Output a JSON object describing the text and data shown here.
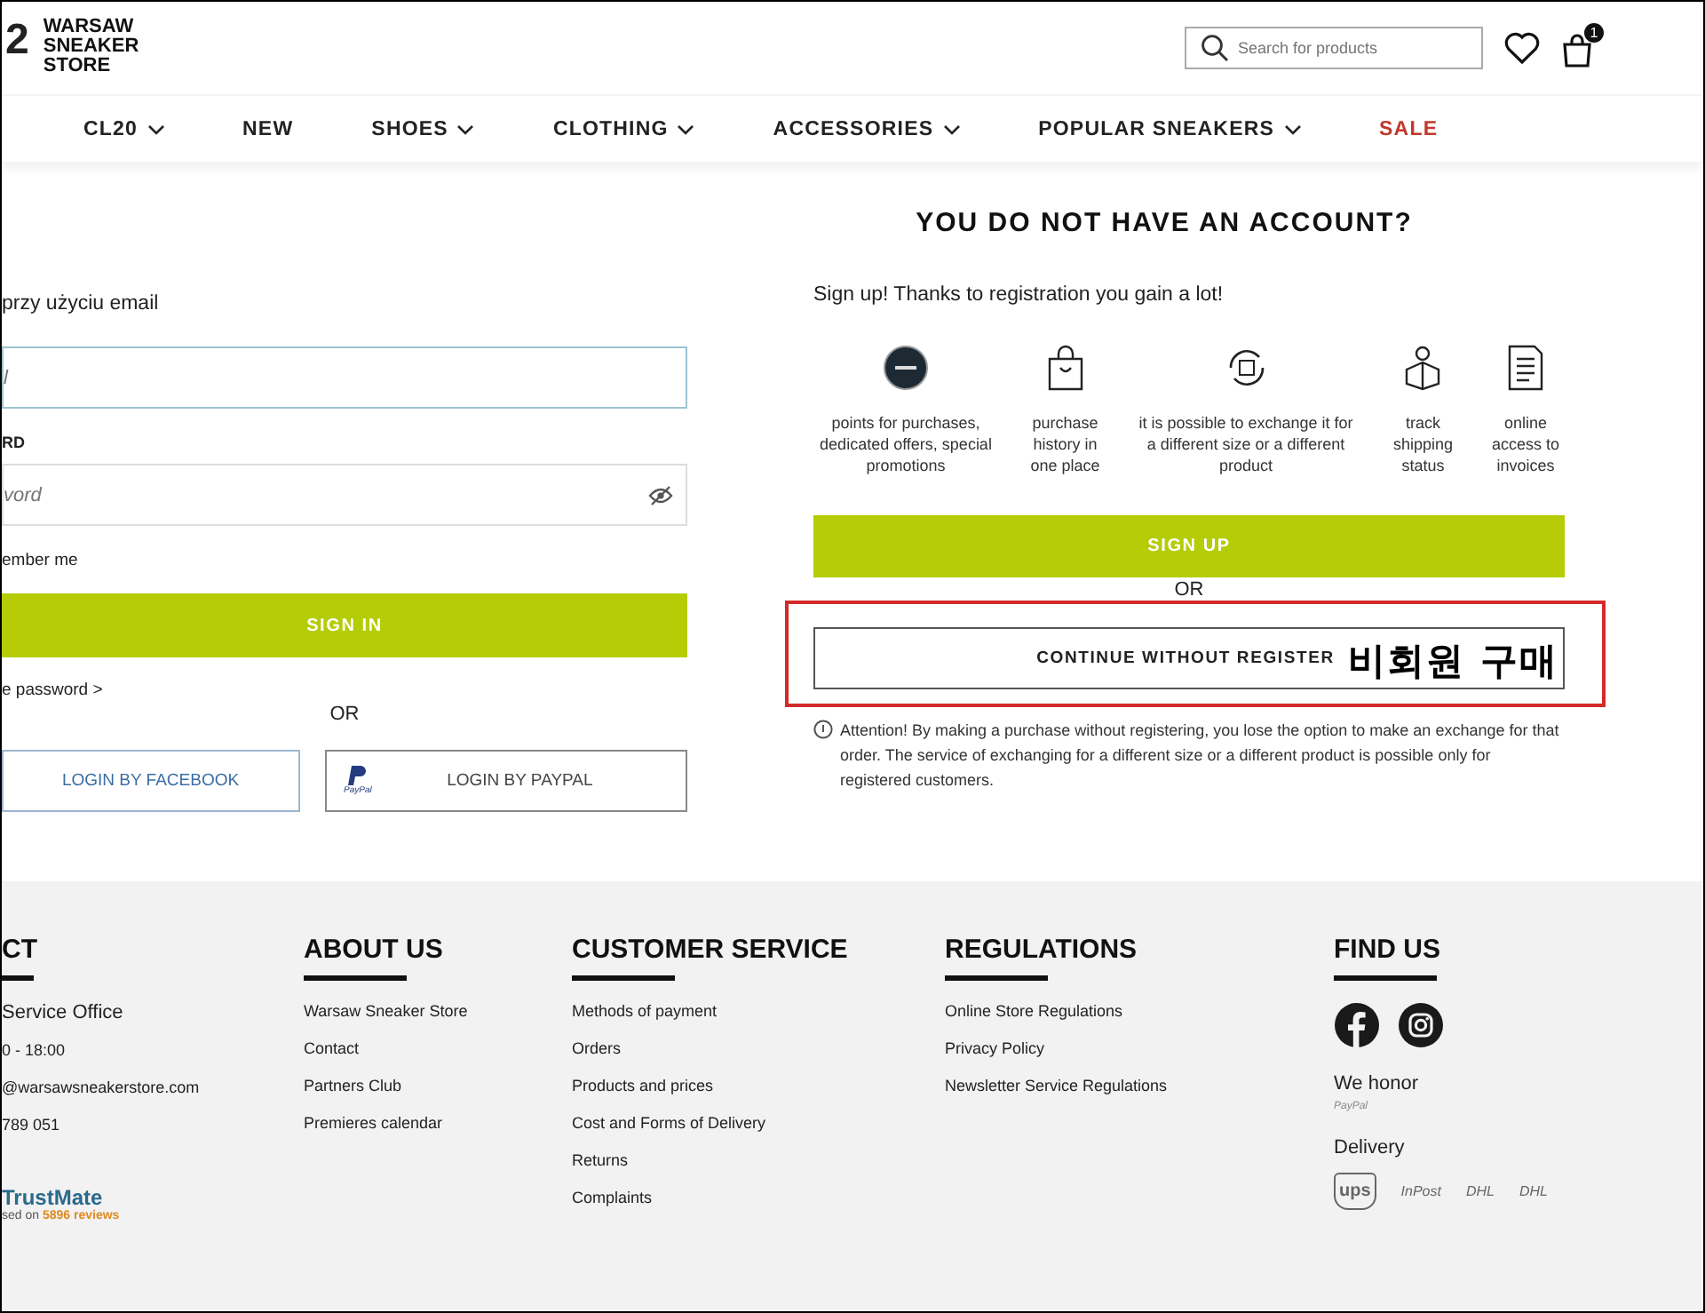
{
  "header": {
    "logo_mark": "2",
    "logo_text": [
      "WARSAW",
      "SNEAKER",
      "STORE"
    ],
    "search": {
      "placeholder": "Search for products"
    },
    "cart_count": "1"
  },
  "nav": [
    {
      "label": "CL20",
      "has_menu": true,
      "highlighted": false
    },
    {
      "label": "NEW",
      "has_menu": false,
      "highlighted": false
    },
    {
      "label": "SHOES",
      "has_menu": true,
      "highlighted": false
    },
    {
      "label": "CLOTHING",
      "has_menu": true,
      "highlighted": false
    },
    {
      "label": "ACCESSORIES",
      "has_menu": true,
      "highlighted": false
    },
    {
      "label": "POPULAR SNEAKERS",
      "has_menu": true,
      "highlighted": false
    },
    {
      "label": "SALE",
      "has_menu": false,
      "highlighted": true
    }
  ],
  "login": {
    "intro": "przy użyciu email",
    "email_field": {
      "placeholder": "l"
    },
    "password_label": "RD",
    "password_field": {
      "placeholder": "vord"
    },
    "remember": "ember me",
    "sign_in": "SIGN IN",
    "forgot": "e password >",
    "or": "OR",
    "facebook": "LOGIN BY FACEBOOK",
    "paypal": "LOGIN BY PAYPAL",
    "paypal_logo": "PayPal"
  },
  "register": {
    "title": "YOU DO NOT HAVE AN ACCOUNT?",
    "intro": "Sign up! Thanks to registration you gain a lot!",
    "benefits": [
      {
        "kind": "club",
        "text": "points for purchases, dedicated offers, special promotions"
      },
      {
        "kind": "bag",
        "text": "purchase history in one place"
      },
      {
        "kind": "exchange",
        "text": "it is possible to exchange it for a different size or a different product"
      },
      {
        "kind": "tracking",
        "text": "track shipping status"
      },
      {
        "kind": "invoice",
        "text": "online access to invoices"
      }
    ],
    "sign_up": "SIGN UP",
    "or": "OR",
    "continue": "CONTINUE WITHOUT REGISTER",
    "annotation": "비회원 구매",
    "attention": "Attention! By making a purchase without registering, you lose the option to make an exchange for that order. The service of exchanging for a different size or a different product is possible only for registered customers."
  },
  "footer": {
    "contact": {
      "heading": "CT",
      "office": "Service Office",
      "lines": [
        "0 - 18:00",
        "@warsawsneakerstore.com",
        "789 051"
      ],
      "trust_brand": "TrustMate",
      "trust_prefix": "sed on",
      "trust_count": "5896 reviews"
    },
    "columns": [
      {
        "heading": "ABOUT US",
        "links": [
          "Warsaw Sneaker Store",
          "Contact",
          "Partners Club",
          "Premieres calendar"
        ]
      },
      {
        "heading": "CUSTOMER SERVICE",
        "links": [
          "Methods of payment",
          "Orders",
          "Products and prices",
          "Cost and Forms of Delivery",
          "Returns",
          "Complaints"
        ]
      },
      {
        "heading": "REGULATIONS",
        "links": [
          "Online Store Regulations",
          "Privacy Policy",
          "Newsletter Service Regulations"
        ]
      }
    ],
    "find_us": {
      "heading": "FIND US",
      "honor": "We honor",
      "honor_logo": "PayPal",
      "delivery": "Delivery",
      "carriers": [
        "ups",
        "InPost",
        "DHL",
        "DHL"
      ]
    }
  }
}
